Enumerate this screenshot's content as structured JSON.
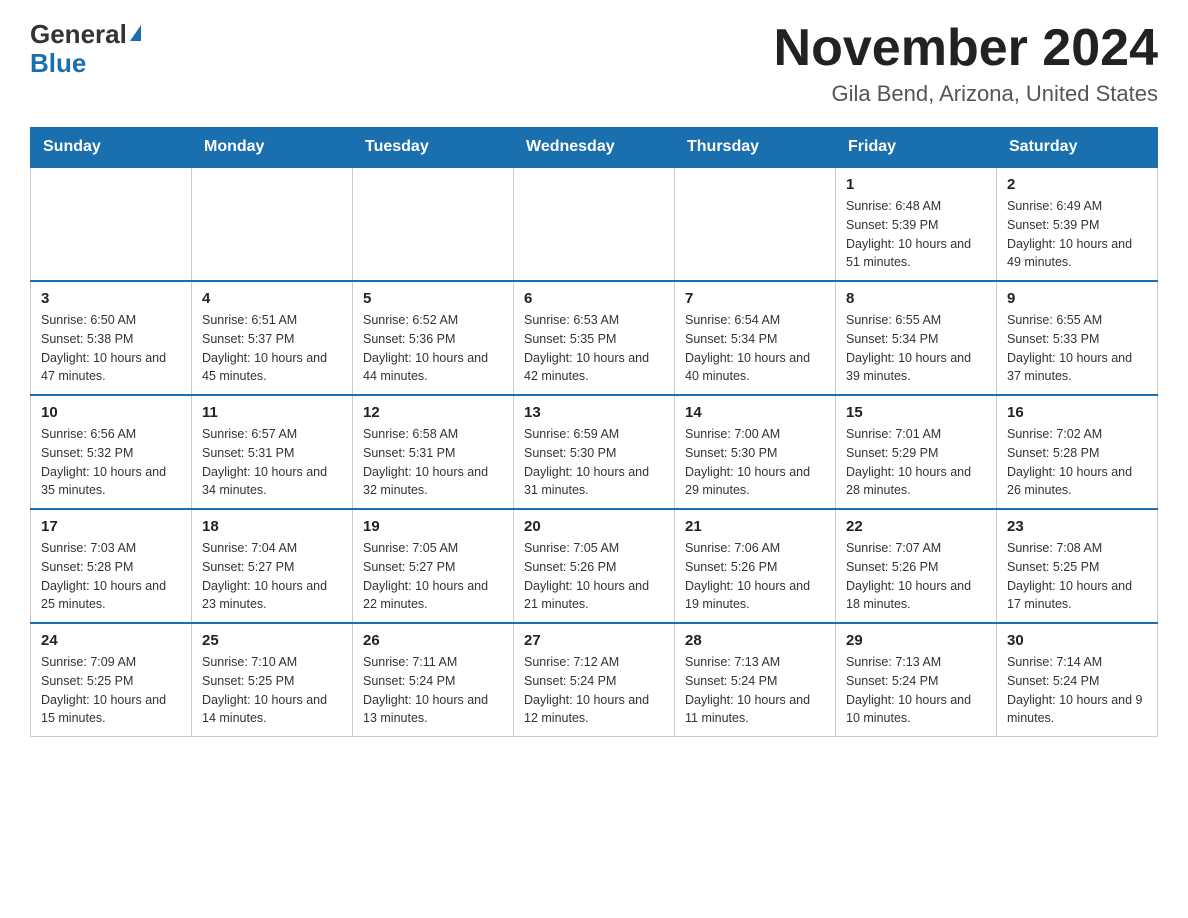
{
  "logo": {
    "line1": "General",
    "triangle": "▶",
    "line2": "Blue"
  },
  "title": "November 2024",
  "subtitle": "Gila Bend, Arizona, United States",
  "weekdays": [
    "Sunday",
    "Monday",
    "Tuesday",
    "Wednesday",
    "Thursday",
    "Friday",
    "Saturday"
  ],
  "weeks": [
    [
      {
        "day": "",
        "info": ""
      },
      {
        "day": "",
        "info": ""
      },
      {
        "day": "",
        "info": ""
      },
      {
        "day": "",
        "info": ""
      },
      {
        "day": "",
        "info": ""
      },
      {
        "day": "1",
        "info": "Sunrise: 6:48 AM\nSunset: 5:39 PM\nDaylight: 10 hours and 51 minutes."
      },
      {
        "day": "2",
        "info": "Sunrise: 6:49 AM\nSunset: 5:39 PM\nDaylight: 10 hours and 49 minutes."
      }
    ],
    [
      {
        "day": "3",
        "info": "Sunrise: 6:50 AM\nSunset: 5:38 PM\nDaylight: 10 hours and 47 minutes."
      },
      {
        "day": "4",
        "info": "Sunrise: 6:51 AM\nSunset: 5:37 PM\nDaylight: 10 hours and 45 minutes."
      },
      {
        "day": "5",
        "info": "Sunrise: 6:52 AM\nSunset: 5:36 PM\nDaylight: 10 hours and 44 minutes."
      },
      {
        "day": "6",
        "info": "Sunrise: 6:53 AM\nSunset: 5:35 PM\nDaylight: 10 hours and 42 minutes."
      },
      {
        "day": "7",
        "info": "Sunrise: 6:54 AM\nSunset: 5:34 PM\nDaylight: 10 hours and 40 minutes."
      },
      {
        "day": "8",
        "info": "Sunrise: 6:55 AM\nSunset: 5:34 PM\nDaylight: 10 hours and 39 minutes."
      },
      {
        "day": "9",
        "info": "Sunrise: 6:55 AM\nSunset: 5:33 PM\nDaylight: 10 hours and 37 minutes."
      }
    ],
    [
      {
        "day": "10",
        "info": "Sunrise: 6:56 AM\nSunset: 5:32 PM\nDaylight: 10 hours and 35 minutes."
      },
      {
        "day": "11",
        "info": "Sunrise: 6:57 AM\nSunset: 5:31 PM\nDaylight: 10 hours and 34 minutes."
      },
      {
        "day": "12",
        "info": "Sunrise: 6:58 AM\nSunset: 5:31 PM\nDaylight: 10 hours and 32 minutes."
      },
      {
        "day": "13",
        "info": "Sunrise: 6:59 AM\nSunset: 5:30 PM\nDaylight: 10 hours and 31 minutes."
      },
      {
        "day": "14",
        "info": "Sunrise: 7:00 AM\nSunset: 5:30 PM\nDaylight: 10 hours and 29 minutes."
      },
      {
        "day": "15",
        "info": "Sunrise: 7:01 AM\nSunset: 5:29 PM\nDaylight: 10 hours and 28 minutes."
      },
      {
        "day": "16",
        "info": "Sunrise: 7:02 AM\nSunset: 5:28 PM\nDaylight: 10 hours and 26 minutes."
      }
    ],
    [
      {
        "day": "17",
        "info": "Sunrise: 7:03 AM\nSunset: 5:28 PM\nDaylight: 10 hours and 25 minutes."
      },
      {
        "day": "18",
        "info": "Sunrise: 7:04 AM\nSunset: 5:27 PM\nDaylight: 10 hours and 23 minutes."
      },
      {
        "day": "19",
        "info": "Sunrise: 7:05 AM\nSunset: 5:27 PM\nDaylight: 10 hours and 22 minutes."
      },
      {
        "day": "20",
        "info": "Sunrise: 7:05 AM\nSunset: 5:26 PM\nDaylight: 10 hours and 21 minutes."
      },
      {
        "day": "21",
        "info": "Sunrise: 7:06 AM\nSunset: 5:26 PM\nDaylight: 10 hours and 19 minutes."
      },
      {
        "day": "22",
        "info": "Sunrise: 7:07 AM\nSunset: 5:26 PM\nDaylight: 10 hours and 18 minutes."
      },
      {
        "day": "23",
        "info": "Sunrise: 7:08 AM\nSunset: 5:25 PM\nDaylight: 10 hours and 17 minutes."
      }
    ],
    [
      {
        "day": "24",
        "info": "Sunrise: 7:09 AM\nSunset: 5:25 PM\nDaylight: 10 hours and 15 minutes."
      },
      {
        "day": "25",
        "info": "Sunrise: 7:10 AM\nSunset: 5:25 PM\nDaylight: 10 hours and 14 minutes."
      },
      {
        "day": "26",
        "info": "Sunrise: 7:11 AM\nSunset: 5:24 PM\nDaylight: 10 hours and 13 minutes."
      },
      {
        "day": "27",
        "info": "Sunrise: 7:12 AM\nSunset: 5:24 PM\nDaylight: 10 hours and 12 minutes."
      },
      {
        "day": "28",
        "info": "Sunrise: 7:13 AM\nSunset: 5:24 PM\nDaylight: 10 hours and 11 minutes."
      },
      {
        "day": "29",
        "info": "Sunrise: 7:13 AM\nSunset: 5:24 PM\nDaylight: 10 hours and 10 minutes."
      },
      {
        "day": "30",
        "info": "Sunrise: 7:14 AM\nSunset: 5:24 PM\nDaylight: 10 hours and 9 minutes."
      }
    ]
  ]
}
